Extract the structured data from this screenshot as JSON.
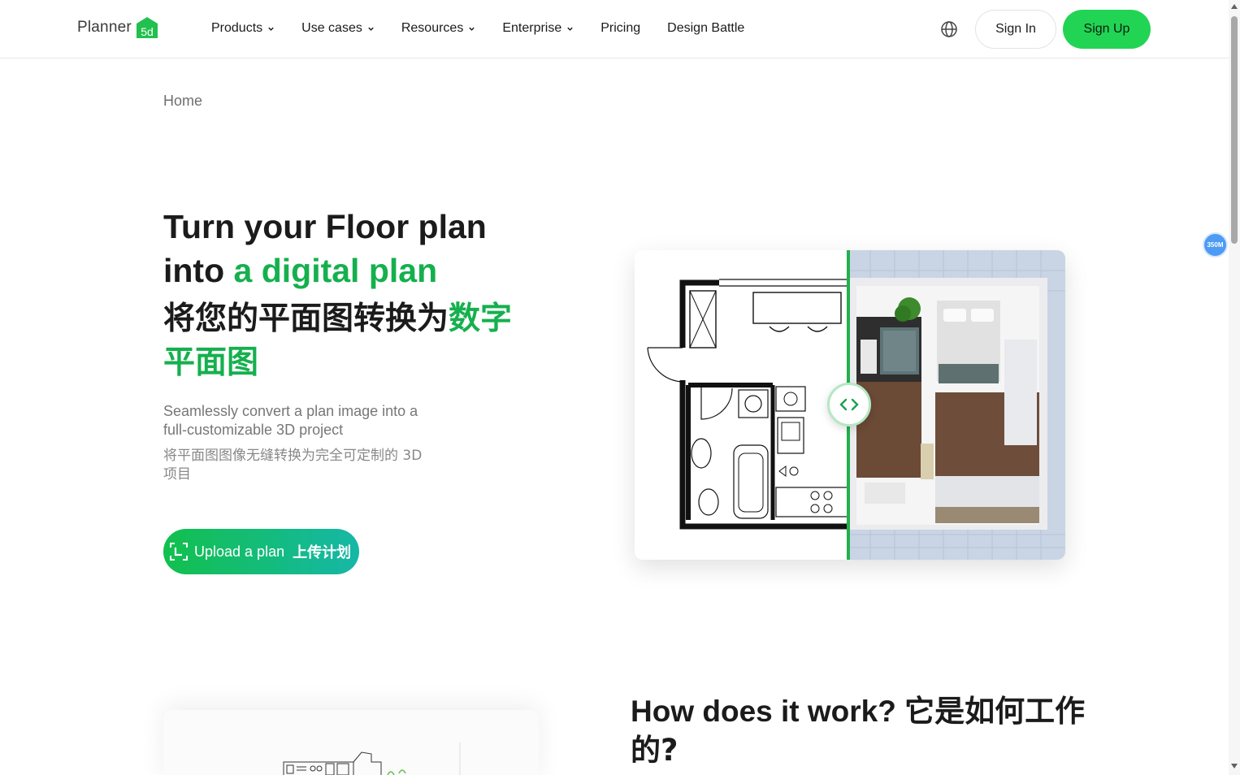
{
  "header": {
    "logo_text": "Planner",
    "logo_mark": "5d",
    "nav": [
      {
        "label": "Products",
        "dropdown": true
      },
      {
        "label": "Use cases",
        "dropdown": true
      },
      {
        "label": "Resources",
        "dropdown": true
      },
      {
        "label": "Enterprise",
        "dropdown": true
      },
      {
        "label": "Pricing",
        "dropdown": false
      },
      {
        "label": "Design Battle",
        "dropdown": false
      }
    ],
    "globe_icon": "globe-icon",
    "sign_in": "Sign In",
    "sign_up": "Sign Up"
  },
  "breadcrumb": {
    "home": "Home"
  },
  "hero": {
    "title_line1": "Turn your Floor plan",
    "title_into": "into ",
    "title_highlight": "a digital plan",
    "title_zh_main": "将您的平面图转换为",
    "title_zh_highlight_1": "数字",
    "title_zh_highlight_2": "平面图",
    "subtitle": "Seamlessly convert a plan image into a full-customizable 3D project",
    "subtitle_zh": "将平面图图像无缝转换为完全可定制的 3D 项目",
    "upload_label": "Upload a plan",
    "upload_label_zh": "上传计划"
  },
  "how": {
    "title": "How does it work?",
    "title_zh": "它是如何工作的?"
  },
  "overlay": {
    "badge": "350M"
  },
  "colors": {
    "brand_green": "#22d454",
    "accent_green": "#15b04e",
    "teal": "#16b7a7"
  }
}
